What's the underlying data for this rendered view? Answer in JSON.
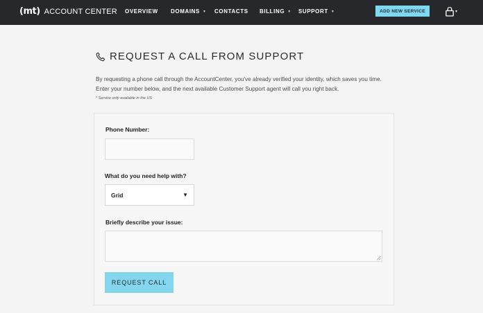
{
  "header": {
    "logo_mark": "(mt)",
    "logo_text": "ACCOUNT CENTER",
    "nav": [
      {
        "label": "OVERVIEW"
      },
      {
        "label": "DOMAINS"
      },
      {
        "label": "CONTACTS"
      },
      {
        "label": "BILLING"
      },
      {
        "label": "SUPPORT"
      }
    ],
    "add_service_label": "ADD NEW SERVICE",
    "user_icon": "user-icon"
  },
  "page": {
    "title_icon": "phone-icon",
    "title": "REQUEST A CALL FROM SUPPORT",
    "intro": "By requesting a phone call through the AccountCenter, you've already verified your identity, which saves you time. Enter your number below, and the next available Customer Support agent will call you right back.",
    "note": "* Service only available in the US"
  },
  "form": {
    "phone_label": "Phone Number:",
    "phone_value": "",
    "help_label": "What do you need help with?",
    "help_value": "Grid",
    "issue_label": "Briefly describe your issue:",
    "issue_value": "",
    "submit_label": "REQUEST CALL"
  },
  "colors": {
    "header_bg": "#26282b",
    "accent": "#84d6ef",
    "page_bg": "#f4f4f4"
  }
}
